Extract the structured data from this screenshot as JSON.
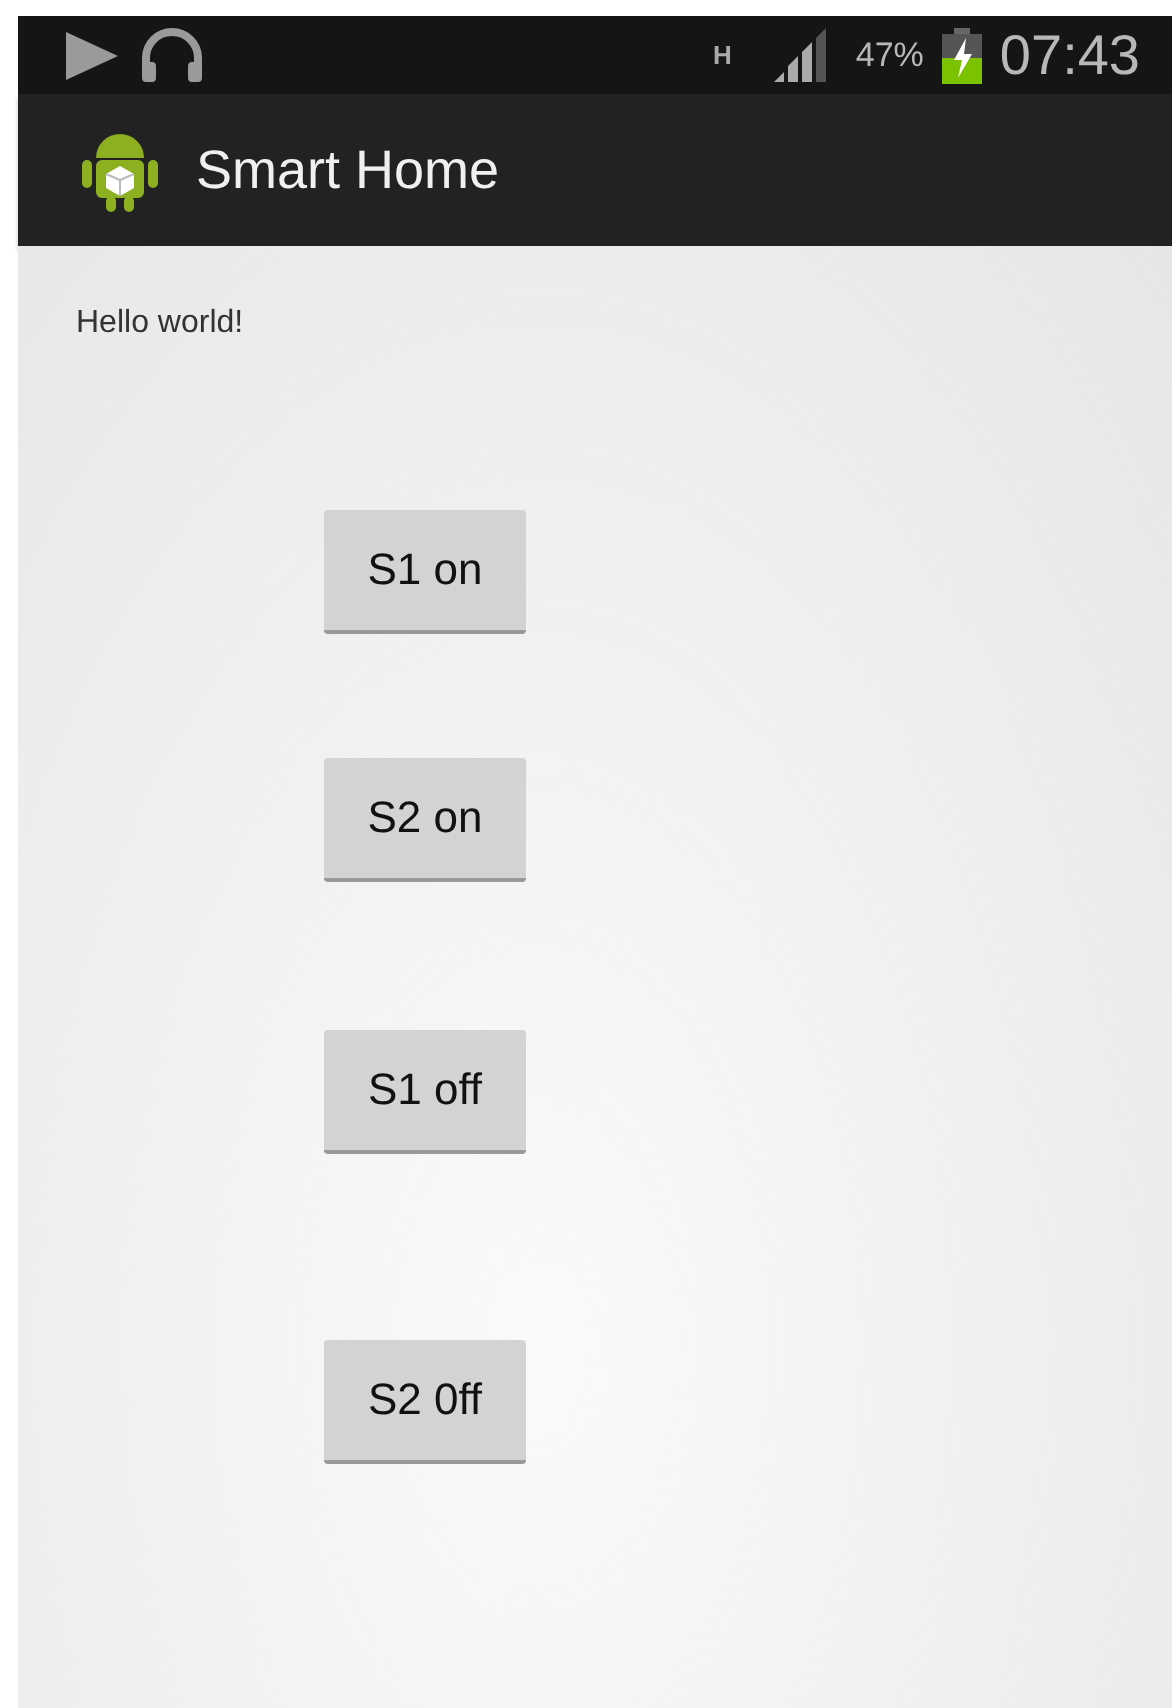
{
  "status_bar": {
    "network_type": "H",
    "battery": "47%",
    "time": "07:43"
  },
  "action_bar": {
    "title": "Smart Home"
  },
  "content": {
    "text": "Hello world!",
    "buttons": [
      {
        "label": "S1 on"
      },
      {
        "label": "S2 on"
      },
      {
        "label": "S1 off"
      },
      {
        "label": "S2 0ff"
      }
    ]
  }
}
